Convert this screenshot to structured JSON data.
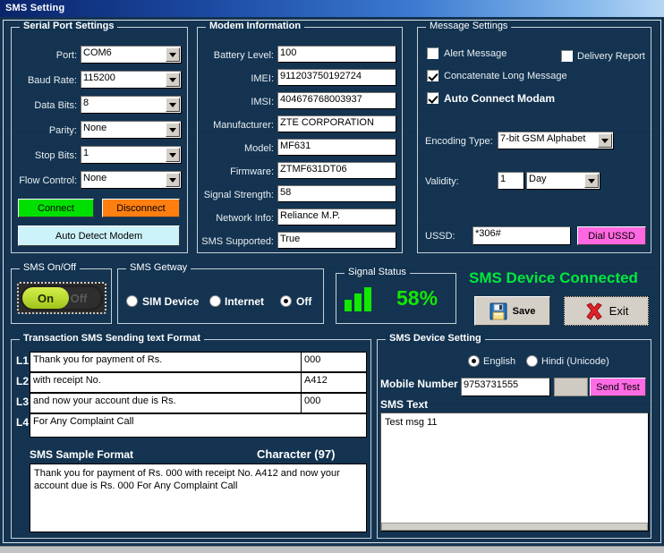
{
  "window": {
    "title": "SMS Setting"
  },
  "serial_port": {
    "caption": "Serial Port Settings",
    "fields": [
      {
        "label": "Port:",
        "value": "COM6"
      },
      {
        "label": "Baud Rate:",
        "value": "115200"
      },
      {
        "label": "Data Bits:",
        "value": "8"
      },
      {
        "label": "Parity:",
        "value": "None"
      },
      {
        "label": "Stop Bits:",
        "value": "1"
      },
      {
        "label": "Flow Control:",
        "value": "None"
      }
    ],
    "connect_label": "Connect",
    "disconnect_label": "Disconnect",
    "auto_detect_label": "Auto Detect Modem"
  },
  "modem_info": {
    "caption": "Modem Information",
    "fields": [
      {
        "label": "Battery Level:",
        "value": "100"
      },
      {
        "label": "IMEI:",
        "value": "911203750192724"
      },
      {
        "label": "IMSI:",
        "value": "404676768003937"
      },
      {
        "label": "Manufacturer:",
        "value": "ZTE CORPORATION"
      },
      {
        "label": "Model:",
        "value": "MF631"
      },
      {
        "label": "Firmware:",
        "value": "ZTMF631DT06"
      },
      {
        "label": "Signal Strength:",
        "value": "58"
      },
      {
        "label": "Network Info:",
        "value": "Reliance M.P."
      },
      {
        "label": "SMS Supported:",
        "value": "True"
      }
    ]
  },
  "message_settings": {
    "caption": "Message Settings",
    "alert_message": {
      "label": "Alert Message",
      "checked": false
    },
    "delivery_report": {
      "label": "Delivery Report",
      "checked": false
    },
    "concatenate": {
      "label": "Concatenate Long Message",
      "checked": true
    },
    "auto_connect": {
      "label": "Auto Connect Modam",
      "checked": true
    },
    "encoding_label": "Encoding Type:",
    "encoding_value": "7-bit GSM Alphabet",
    "validity_label": "Validity:",
    "validity_number": "1",
    "validity_unit": "Day",
    "ussd_label": "USSD:",
    "ussd_value": "*306#",
    "dial_ussd_label": "Dial USSD"
  },
  "sms_onoff": {
    "caption": "SMS On/Off",
    "on_label": "On",
    "off_label": "Off",
    "state": "On"
  },
  "sms_gateway": {
    "caption": "SMS Getway",
    "options": [
      {
        "label": "SIM Device",
        "selected": false
      },
      {
        "label": "Internet",
        "selected": false
      },
      {
        "label": "Off",
        "selected": true
      }
    ]
  },
  "signal_status": {
    "caption": "Signal Status",
    "percent": "58%",
    "bars": 3,
    "color": "#12e800"
  },
  "status": {
    "connected_text": "SMS Device Connected",
    "color": "#00e83c",
    "save_label": "Save",
    "exit_label": "Exit"
  },
  "transaction_format": {
    "caption": "Transaction SMS Sending text Format",
    "rows": [
      {
        "tag": "L1",
        "text": "Thank you for payment of Rs.",
        "value": "000"
      },
      {
        "tag": "L2",
        "text": "with receipt No.",
        "value": "A412"
      },
      {
        "tag": "L3",
        "text": "and now your account due is Rs.",
        "value": "000"
      },
      {
        "tag": "L4",
        "text": "For Any Complaint Call",
        "value": ""
      }
    ],
    "sample_header": "SMS Sample Format",
    "character_count": "Character (97)",
    "sample_text": "Thank you for payment of Rs. 000 with receipt No. A412 and now your account due is Rs. 000 For Any Complaint Call"
  },
  "device_setting": {
    "caption": "SMS Device Setting",
    "language_options": [
      {
        "label": "English",
        "selected": true
      },
      {
        "label": "Hindi (Unicode)",
        "selected": false
      }
    ],
    "mobile_label": "Mobile Number",
    "mobile_value": "9753731555",
    "sms_text_label": "SMS Text",
    "sms_text_value": "Test msg 11",
    "send_test_label": "Send Test"
  }
}
